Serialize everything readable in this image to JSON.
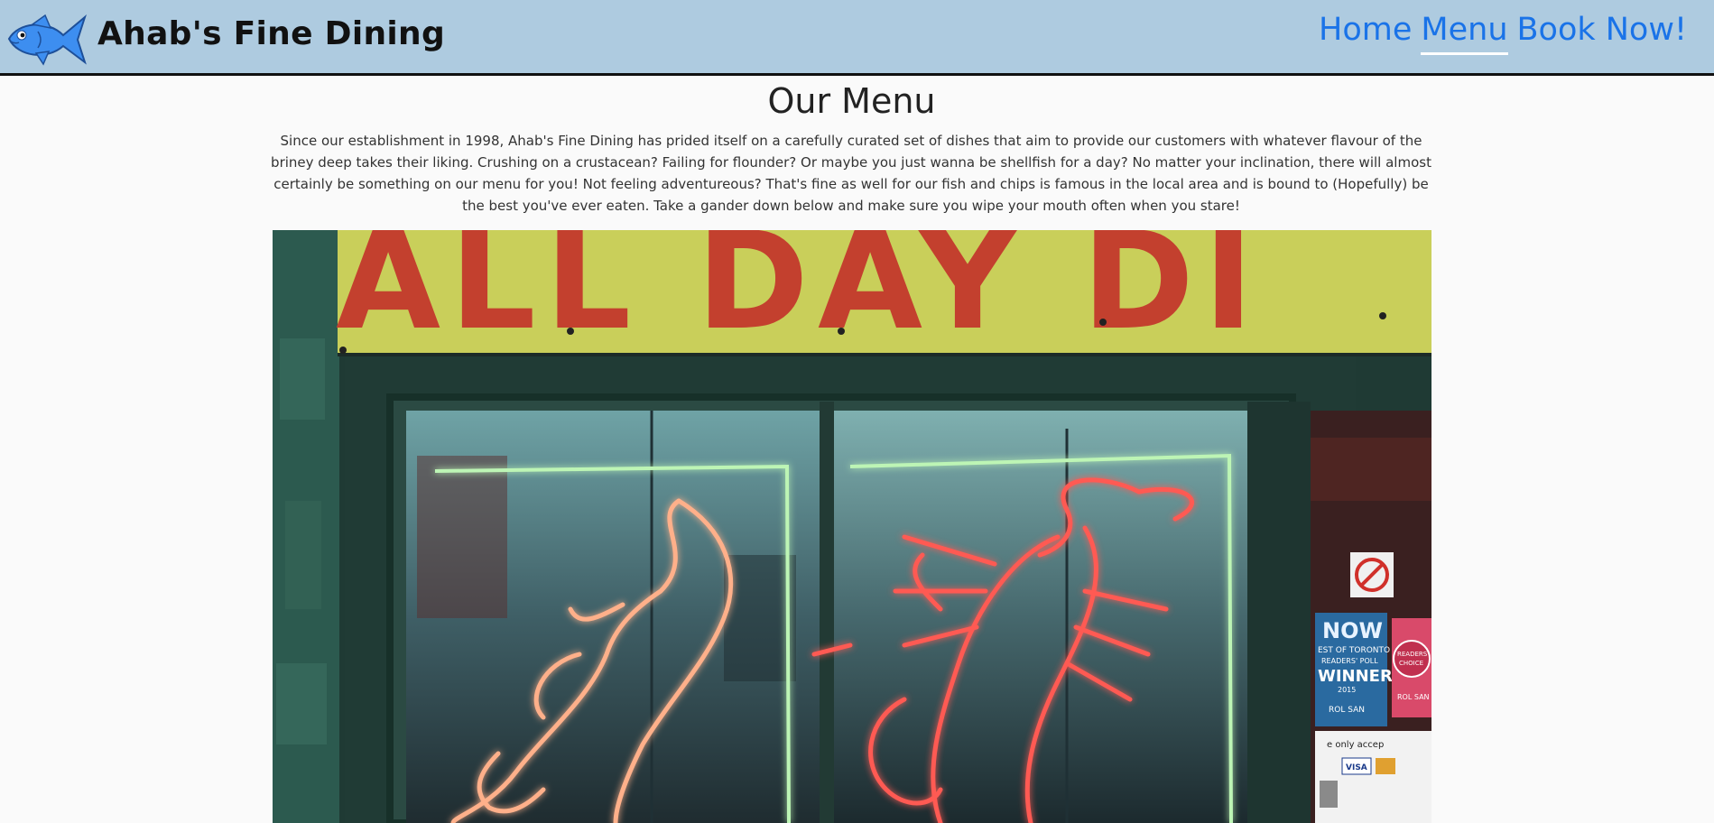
{
  "header": {
    "brand": "Ahab's Fine Dining",
    "nav": {
      "home": "Home",
      "menu": "Menu",
      "book": "Book Now!"
    },
    "active_nav": "Menu",
    "colors": {
      "header_bg": "#aecbe0",
      "nav_link": "#1a73e8",
      "logo_fish": "#3d8ef0"
    }
  },
  "main": {
    "title": "Our Menu",
    "intro": "Since our establishment in 1998, Ahab's Fine Dining has prided itself on a carefully curated set of dishes that aim to provide our customers with whatever flavour of the briney deep takes their liking. Crushing on a crustacean? Failing for flounder? Or maybe you just wanna be shellfish for a day? No matter your inclination, there will almost certainly be something on our menu for you! Not feeling adventureous? That's fine as well for our fish and chips is famous in the local area and is bound to (Hopefully) be the best you've ever eaten. Take a gander down below and make sure you wipe your mouth often when you stare!"
  },
  "hero": {
    "banner_text": "ALL DAY DI",
    "poster_now": "NOW",
    "poster_best": "EST OF TORONTO",
    "poster_readers": "READERS' POLL",
    "poster_winner": "WINNER",
    "poster_year": "2015",
    "poster_name": "ROL SAN",
    "badge_readers": "READERS'",
    "badge_choice": "CHOICE",
    "badge_name": "ROL SAN",
    "sign_accept": "e only accep",
    "sign_visa": "VISA",
    "colors": {
      "banner_bg": "#c9cf5a",
      "banner_letters": "#c3402e",
      "neon_frame": "#bdf5b5",
      "neon_fish": "#ffb08a",
      "neon_lobster": "#ff5a52"
    }
  }
}
